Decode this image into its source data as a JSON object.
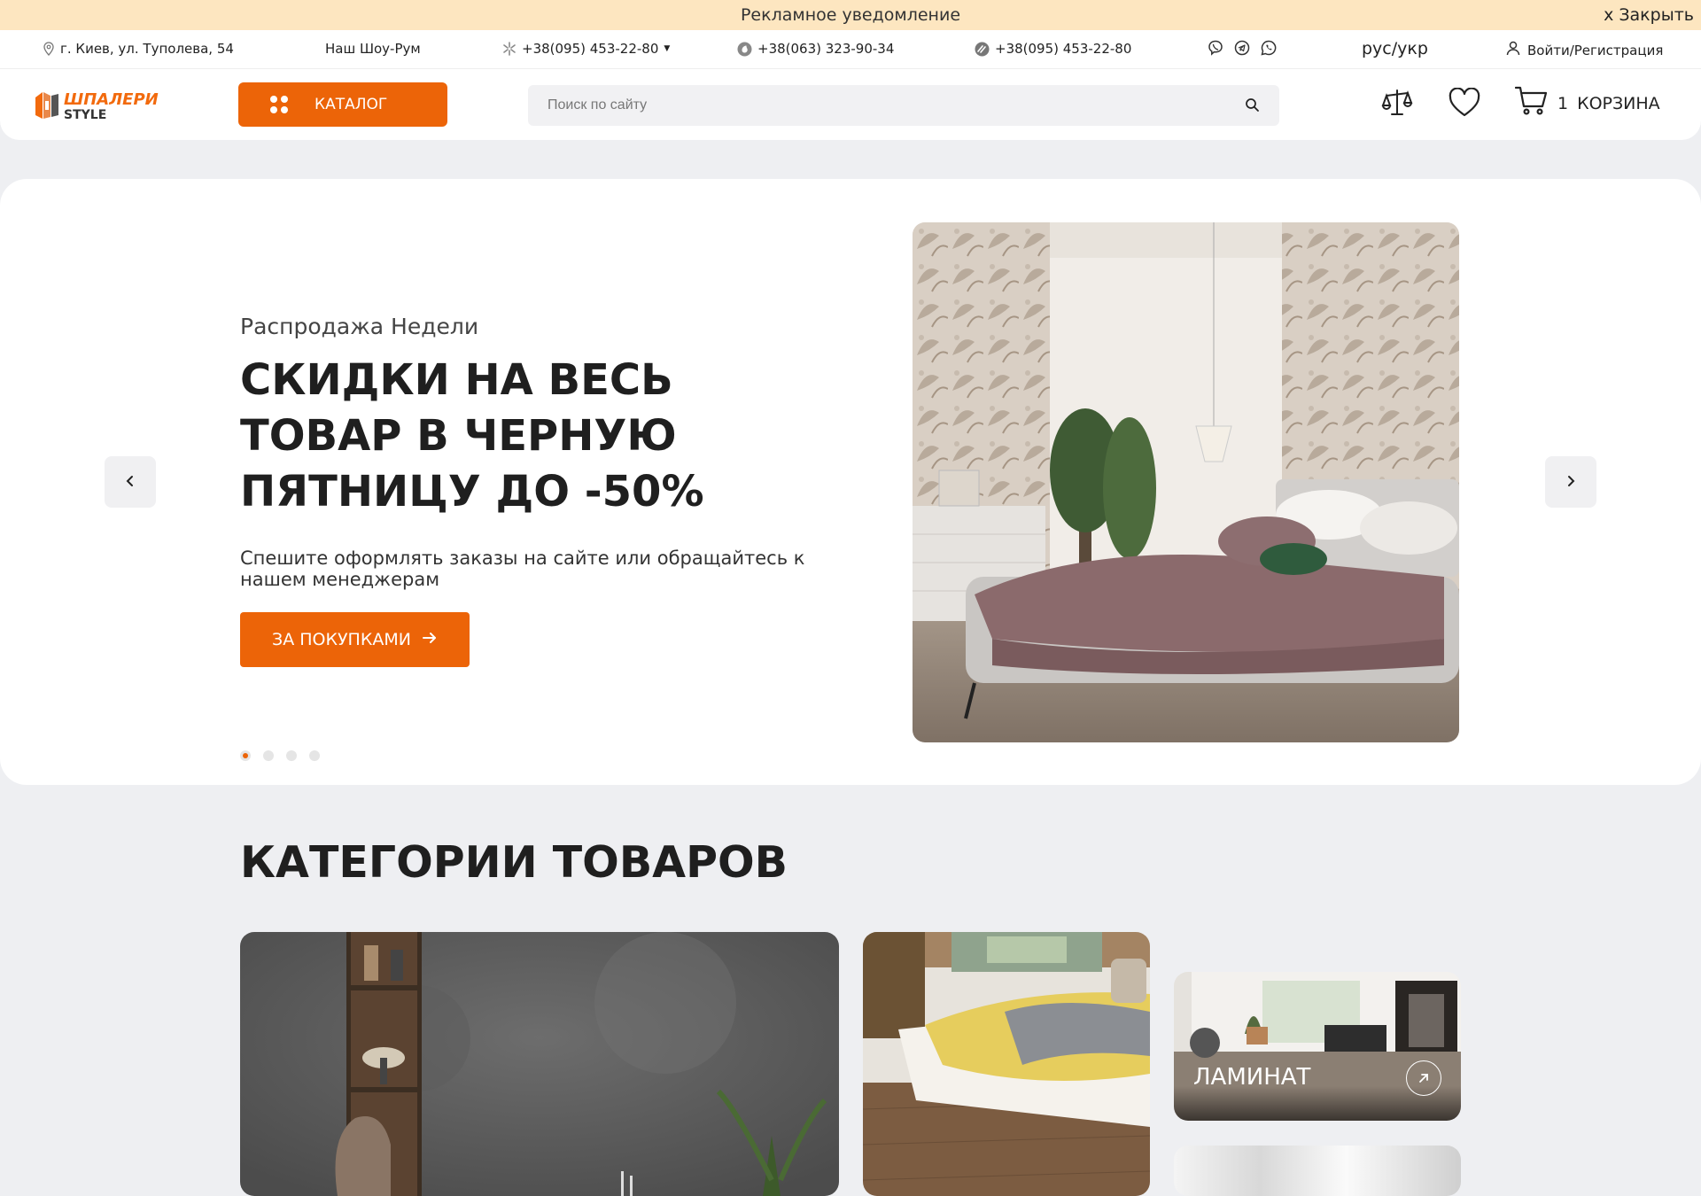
{
  "promo": {
    "text": "Рекламное уведомление",
    "close_label": "x Закрыть"
  },
  "topbar": {
    "address": "г. Киев, ул. Туполева, 54",
    "showroom": "Наш Шоу-Рум",
    "phone1": "+38(095) 453-22-80",
    "phone2": "+38(063) 323-90-34",
    "phone3": "+38(095) 453-22-80",
    "language": "рус/укр",
    "login": "Войти/Регистрация"
  },
  "header": {
    "logo_line1": "ШПАЛЕРИ",
    "logo_line2": "STYLE",
    "catalog_label": "КАТАЛОГ",
    "search_placeholder": "Поиск по сайту",
    "cart_count": "1",
    "cart_label": "КОРЗИНА"
  },
  "hero": {
    "subtitle": "Распродажа Недели",
    "title": "СКИДКИ НА ВЕСЬ ТОВАР В ЧЕРНУЮ ПЯТНИЦУ ДО -50%",
    "description": "Спешите оформлять заказы на сайте или обращайтесь к нашем менеджерам",
    "button_label": "ЗА ПОКУПКАМИ",
    "slides_count": 4,
    "active_slide": 1
  },
  "categories": {
    "title": "КАТЕГОРИИ ТОВАРОВ",
    "items": [
      {
        "label": ""
      },
      {
        "label": ""
      },
      {
        "label": "ЛАМИНАТ"
      },
      {
        "label": ""
      }
    ]
  },
  "colors": {
    "accent": "#ec6408",
    "promo_bg": "#fde6c0",
    "page_bg": "#eeeff2"
  }
}
